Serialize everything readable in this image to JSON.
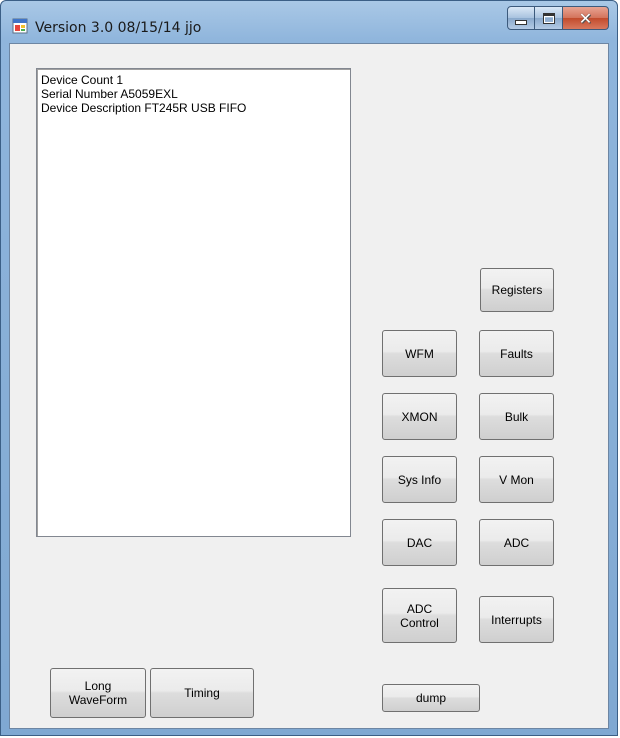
{
  "window": {
    "title": "Version 3.0 08/15/14 jjo"
  },
  "output": {
    "lines": [
      "Device Count 1",
      "Serial Number A5059EXL",
      "Device Description FT245R USB FIFO"
    ]
  },
  "buttons": {
    "registers": "Registers",
    "wfm": "WFM",
    "faults": "Faults",
    "xmon": "XMON",
    "bulk": "Bulk",
    "sys_info": "Sys Info",
    "v_mon": "V Mon",
    "dac": "DAC",
    "adc": "ADC",
    "adc_control": "ADC\nControl",
    "interrupts": "Interrupts",
    "long_waveform": "Long\nWaveForm",
    "timing": "Timing",
    "dump": "dump"
  },
  "icons": {
    "app": "app-window-icon",
    "minimize": "minimize-icon",
    "maximize": "maximize-icon",
    "close": "close-icon"
  }
}
